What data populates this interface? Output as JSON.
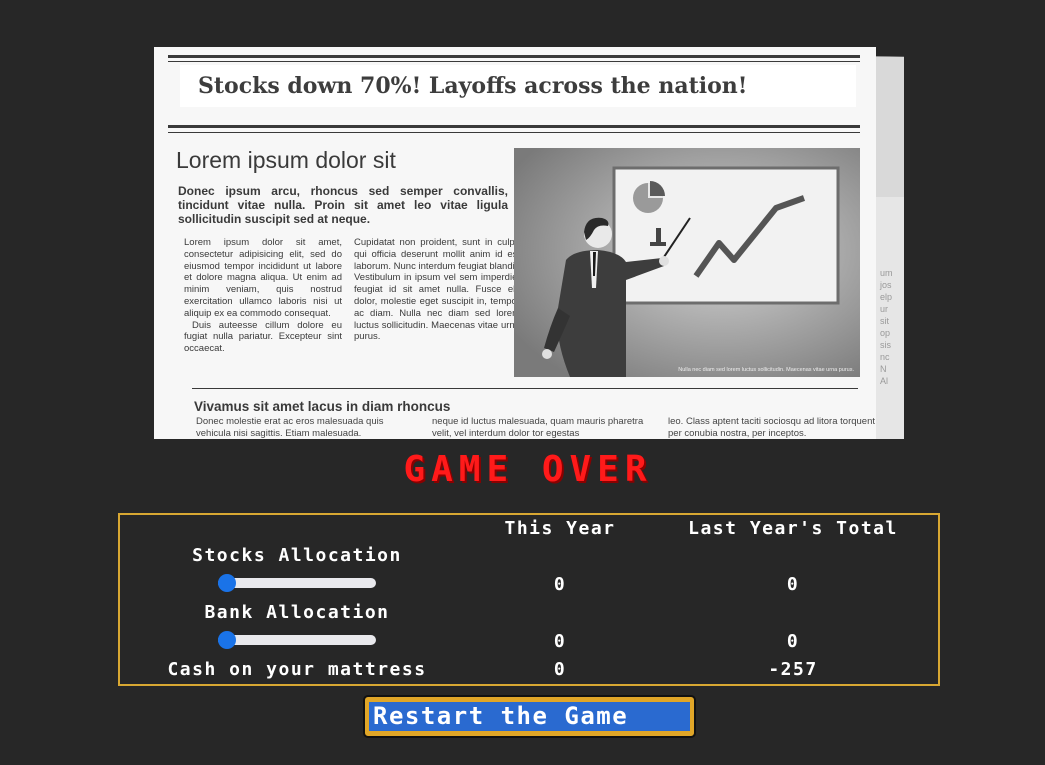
{
  "newspaper": {
    "headline": "Stocks down 70%! Layoffs across the nation!",
    "title": "Lorem ipsum dolor sit",
    "deck": "Donec ipsum arcu, rhoncus sed semper convallis, tincidunt vitae nulla. Proin sit amet leo vitae ligula sollicitudin suscipit sed at neque.",
    "col1_p1": "Lorem ipsum dolor sit amet, consectetur adipisicing elit, sed do eiusmod tempor incididunt ut labore et dolore magna aliqua. Ut enim ad minim veniam, quis nostrud exercitation ullamco laboris nisi ut aliquip ex ea commodo consequat.",
    "col1_p2": "Duis auteesse cillum dolore eu fugiat nulla pariatur. Excepteur sint occaecat.",
    "col2": "Cupidatat non proident, sunt in culpa qui officia deserunt mollit anim id est laborum. Nunc interdum feugiat blandit. Vestibulum in ipsum vel sem imperdiet feugiat id sit amet nulla. Fusce elit dolor, molestie eget suscipit in, tempor ac diam. Nulla nec diam sed lorem luctus sollicitudin. Maecenas vitae urna purus.",
    "photo_caption": "Nulla nec diam sed lorem luctus sollicitudin. Maecenas vitae urna purus.",
    "subhead": "Vivamus sit amet lacus in diam rhoncus",
    "bottom_col1": "Donec molestie erat ac eros malesuada quis vehicula nisi sagittis. Etiam malesuada.",
    "bottom_col2": "neque id luctus malesuada, quam mauris pharetra velit, vel interdum dolor tor egestas",
    "bottom_col3": "leo. Class aptent taciti sociosqu ad litora torquent per conubia nostra, per inceptos.",
    "back_page_text": "um\njos\nelp\nur\nsit\nop\nsis\nnc\nN\nAl"
  },
  "status": "GAME OVER",
  "stats": {
    "col_this_year": "This Year",
    "col_last_year": "Last Year's Total",
    "rows": [
      {
        "label": "Stocks Allocation",
        "slider_value": 0,
        "this_year": "0",
        "last_year": "0"
      },
      {
        "label": "Bank Allocation",
        "slider_value": 0,
        "this_year": "0",
        "last_year": "0"
      },
      {
        "label": "Cash on your mattress",
        "this_year": "0",
        "last_year": "-257"
      }
    ]
  },
  "restart_label": "Restart the Game",
  "colors": {
    "background": "#272727",
    "game_over_red": "#ff1a1a",
    "border_gold": "#d8a732",
    "slider_blue": "#1a73e8",
    "button_blue": "#2a6ad0"
  }
}
